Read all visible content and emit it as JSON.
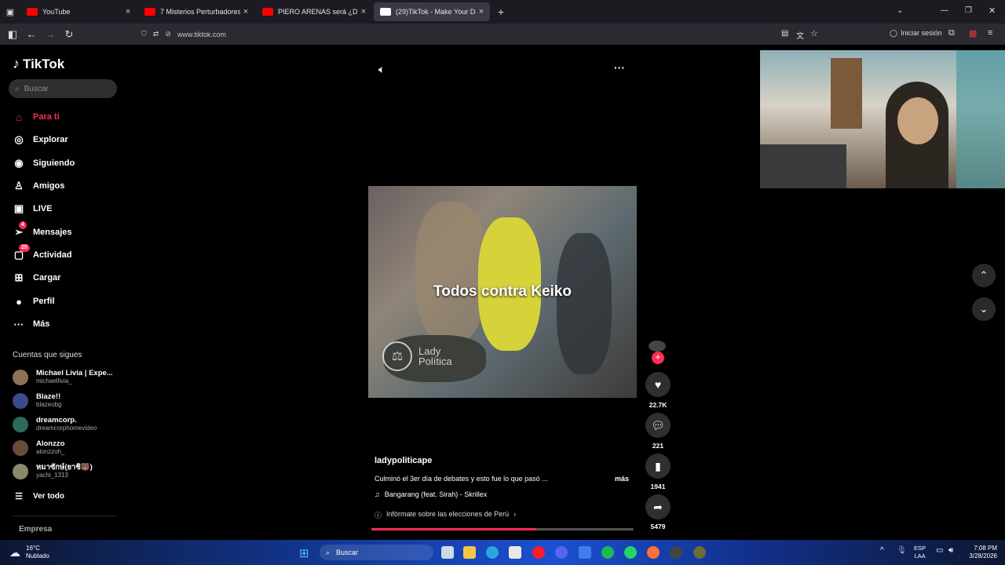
{
  "browser": {
    "tabs": [
      {
        "title": "YouTube",
        "color": "#ff0000",
        "active": false
      },
      {
        "title": "7 Misterios Perturbadores D",
        "color": "#ff0000",
        "active": false
      },
      {
        "title": "PIERO ARENAS será ¿DENU",
        "color": "#ff0000",
        "active": false
      },
      {
        "title": "(29)TikTok - Make Your Day",
        "color": "#ffffff",
        "active": true
      }
    ],
    "url": "www.tiktok.com",
    "signin_label": "Iniciar sesión"
  },
  "sidebar": {
    "logo_text": "TikTok",
    "search_placeholder": "Buscar",
    "nav": [
      {
        "label": "Para ti",
        "icon": "home-icon",
        "glyph": "⌂",
        "active": true,
        "badge": ""
      },
      {
        "label": "Explorar",
        "icon": "compass-icon",
        "glyph": "◎",
        "active": false,
        "badge": ""
      },
      {
        "label": "Siguiendo",
        "icon": "following-icon",
        "glyph": "◉",
        "active": false,
        "badge": ""
      },
      {
        "label": "Amigos",
        "icon": "friends-icon",
        "glyph": "♙",
        "active": false,
        "badge": ""
      },
      {
        "label": "LIVE",
        "icon": "live-icon",
        "glyph": "▣",
        "active": false,
        "badge": ""
      },
      {
        "label": "Mensajes",
        "icon": "messages-icon",
        "glyph": "➢",
        "active": false,
        "badge": "4"
      },
      {
        "label": "Actividad",
        "icon": "activity-icon",
        "glyph": "▢",
        "active": false,
        "badge": "25"
      },
      {
        "label": "Cargar",
        "icon": "upload-icon",
        "glyph": "⊞",
        "active": false,
        "badge": ""
      },
      {
        "label": "Perfil",
        "icon": "profile-avatar-icon",
        "glyph": "●",
        "active": false,
        "badge": ""
      },
      {
        "label": "Más",
        "icon": "more-icon",
        "glyph": "···",
        "active": false,
        "badge": ""
      }
    ],
    "following_title": "Cuentas que sigues",
    "accounts": [
      {
        "name": "Michael Livia | Expe...",
        "handle": "michaellivia_"
      },
      {
        "name": "Blaze!!",
        "handle": "blazeobg"
      },
      {
        "name": "dreamcorp.",
        "handle": "dreamcorphomevideo"
      },
      {
        "name": "Alonzzo",
        "handle": "alonzzoh_"
      },
      {
        "name": "หมาซักษ์(ยาชิ🐻)",
        "handle": "yachi_1313"
      }
    ],
    "see_all": "Ver todo",
    "footer": "Empresa"
  },
  "video": {
    "caption_overlay": "Todos contra Keiko",
    "watermark_line1": "Lady",
    "watermark_line2": "Política",
    "author": "ladypoliticape",
    "description": "Culminó el 3er día de debates y esto fue lo que pasó ...",
    "more": "más",
    "music": "Bangarang (feat. Sirah) - Skrillex",
    "election_link": "Infórmate sobre las elecciones de Perú",
    "likes": "22.7K",
    "comments": "221",
    "saves": "1941",
    "shares": "5479",
    "progress_fraction": 0.63,
    "accent": "#fe2c55"
  },
  "taskbar": {
    "weather_temp": "16°C",
    "weather_desc": "Nublado",
    "search_placeholder": "Buscar",
    "lang1": "ESP",
    "lang2": "LAA",
    "time": "7:08 PM",
    "date": "3/28/2026"
  }
}
